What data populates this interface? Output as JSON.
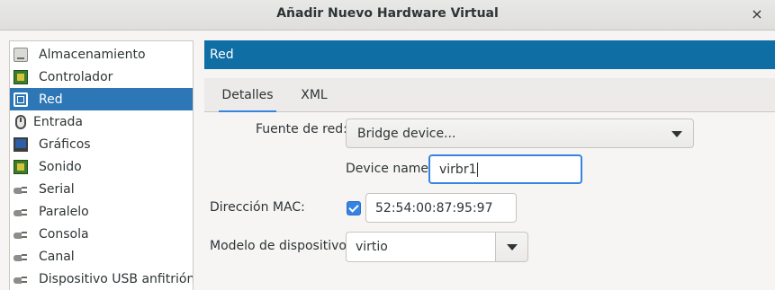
{
  "window": {
    "title": "Añadir Nuevo Hardware Virtual",
    "close_symbol": "×"
  },
  "sidebar": {
    "items": [
      {
        "label": "Almacenamiento",
        "icon": "disk-icon",
        "selected": false
      },
      {
        "label": "Controlador",
        "icon": "chip-icon",
        "selected": false
      },
      {
        "label": "Red",
        "icon": "network-icon",
        "selected": true
      },
      {
        "label": "Entrada",
        "icon": "mouse-icon",
        "selected": false
      },
      {
        "label": "Gráficos",
        "icon": "monitor-icon",
        "selected": false
      },
      {
        "label": "Sonido",
        "icon": "sound-card-icon",
        "selected": false
      },
      {
        "label": "Serial",
        "icon": "serial-plug-icon",
        "selected": false
      },
      {
        "label": "Paralelo",
        "icon": "parallel-plug-icon",
        "selected": false
      },
      {
        "label": "Consola",
        "icon": "console-plug-icon",
        "selected": false
      },
      {
        "label": "Canal",
        "icon": "channel-plug-icon",
        "selected": false
      },
      {
        "label": "Dispositivo USB anfitrión",
        "icon": "usb-plug-icon",
        "selected": false
      }
    ]
  },
  "main": {
    "header": "Red",
    "tabs": [
      {
        "label": "Detalles",
        "active": true
      },
      {
        "label": "XML",
        "active": false
      }
    ],
    "form": {
      "network_source_label": "Fuente de red:",
      "network_source_value": "Bridge device...",
      "device_name_label": "Device name:",
      "device_name_value": "virbr1",
      "mac_label": "Dirección MAC:",
      "mac_checked": true,
      "mac_value": "52:54:00:87:95:97",
      "model_label": "Modelo de dispositivo:",
      "model_value": "virtio"
    }
  },
  "colors": {
    "selection": "#2d77b6",
    "header": "#0f6ea3",
    "accent": "#3584e4"
  }
}
